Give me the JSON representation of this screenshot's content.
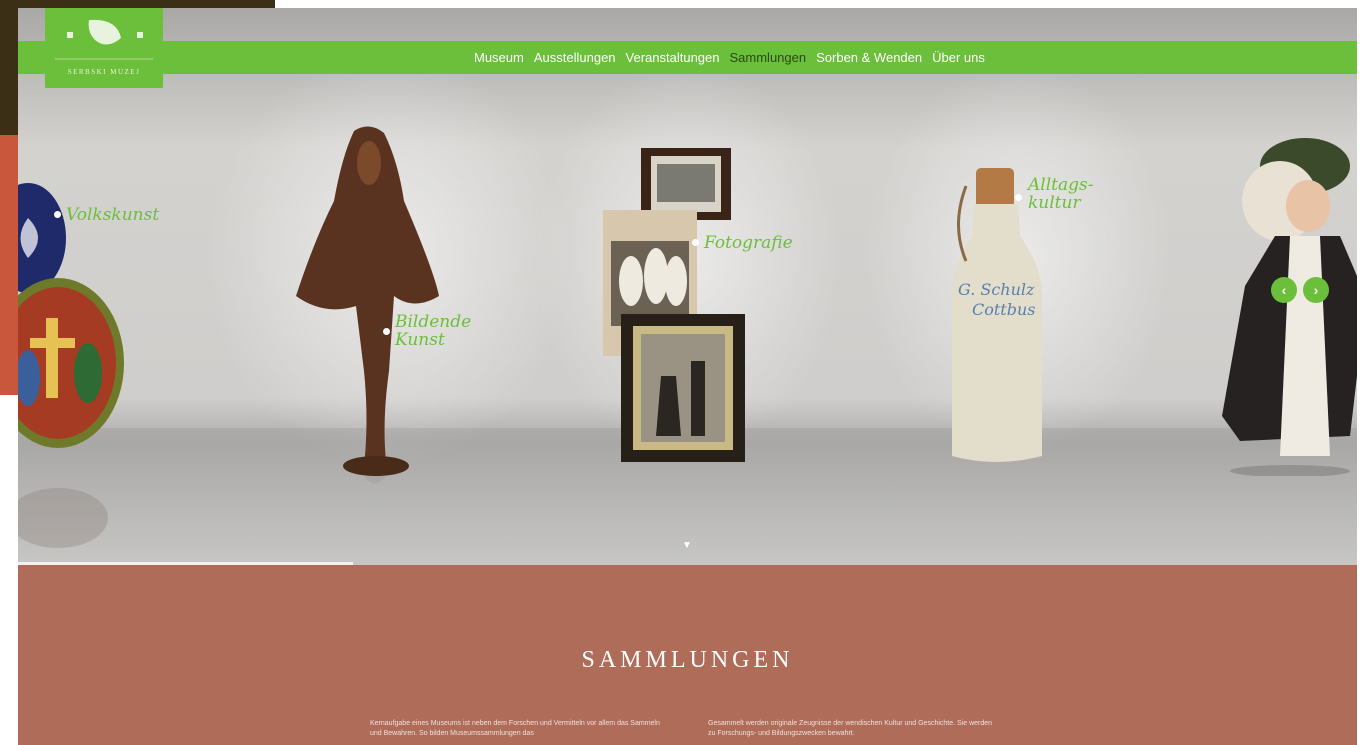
{
  "nav": {
    "items": [
      {
        "label": "Museum"
      },
      {
        "label": "Ausstellungen"
      },
      {
        "label": "Veranstaltungen"
      },
      {
        "label": "Sammlungen",
        "active": true
      },
      {
        "label": "Sorben & Wenden"
      },
      {
        "label": "Über uns"
      }
    ]
  },
  "logo": {
    "text": "SERBSKI MUZEJ"
  },
  "hero": {
    "labels": {
      "volkskunst": "Volkskunst",
      "bildende_line1": "Bildende",
      "bildende_line2": "Kunst",
      "fotografie": "Fotografie",
      "alltags_line1": "Alltags-",
      "alltags_line2": "kultur"
    },
    "bottle_text_line1": "G. Schulz",
    "bottle_text_line2": "Cottbus",
    "prev_icon": "chevron-left-icon",
    "next_icon": "chevron-right-icon",
    "scroll_down_icon": "triangle-down-icon",
    "slider_progress_percent": 25
  },
  "section": {
    "title": "SAMMLUNGEN",
    "para_left": "Kernaufgabe eines Museums ist neben dem Forschen und Vermitteln vor allem das Sammeln und Bewahren. So bilden Museumssammlungen das",
    "para_right": "Gesammelt werden originale Zeugnisse der wendischen Kultur und Geschichte. Sie werden zu Forschungs- und Bildungszwecken bewahrt."
  },
  "colors": {
    "accent_green": "#6bbf3a",
    "section_bg": "#ae6c59",
    "hero_bg": "#c9c8c5"
  }
}
